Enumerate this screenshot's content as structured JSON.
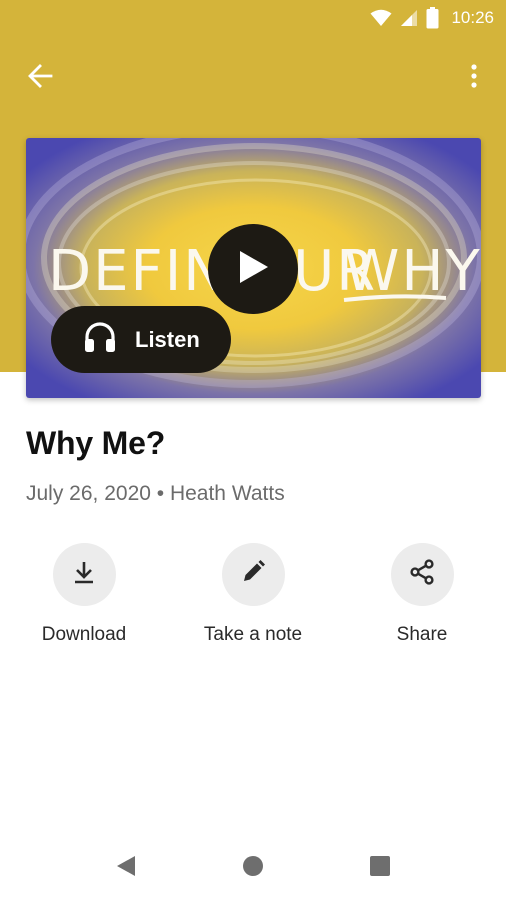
{
  "status_bar": {
    "time": "10:26"
  },
  "app_bar": {
    "back_icon": "arrow-left-icon",
    "more_icon": "more-vertical-icon"
  },
  "hero": {
    "artwork_text": [
      "DEFINE",
      "YOUR",
      "WHY"
    ],
    "play_icon": "play-icon",
    "listen_label": "Listen",
    "listen_icon": "headphones-icon"
  },
  "episode": {
    "title": "Why Me?",
    "meta": "July 26, 2020 • Heath Watts"
  },
  "actions": [
    {
      "label": "Download",
      "icon": "download-icon"
    },
    {
      "label": "Take a note",
      "icon": "pencil-icon"
    },
    {
      "label": "Share",
      "icon": "share-icon"
    }
  ],
  "nav": {
    "back": "nav-back-icon",
    "home": "nav-home-icon",
    "recents": "nav-recents-icon"
  },
  "colors": {
    "header": "#d4b43a",
    "dark_button": "#1d1a14",
    "action_bg": "#ececec",
    "meta_text": "#6b6b6b"
  }
}
